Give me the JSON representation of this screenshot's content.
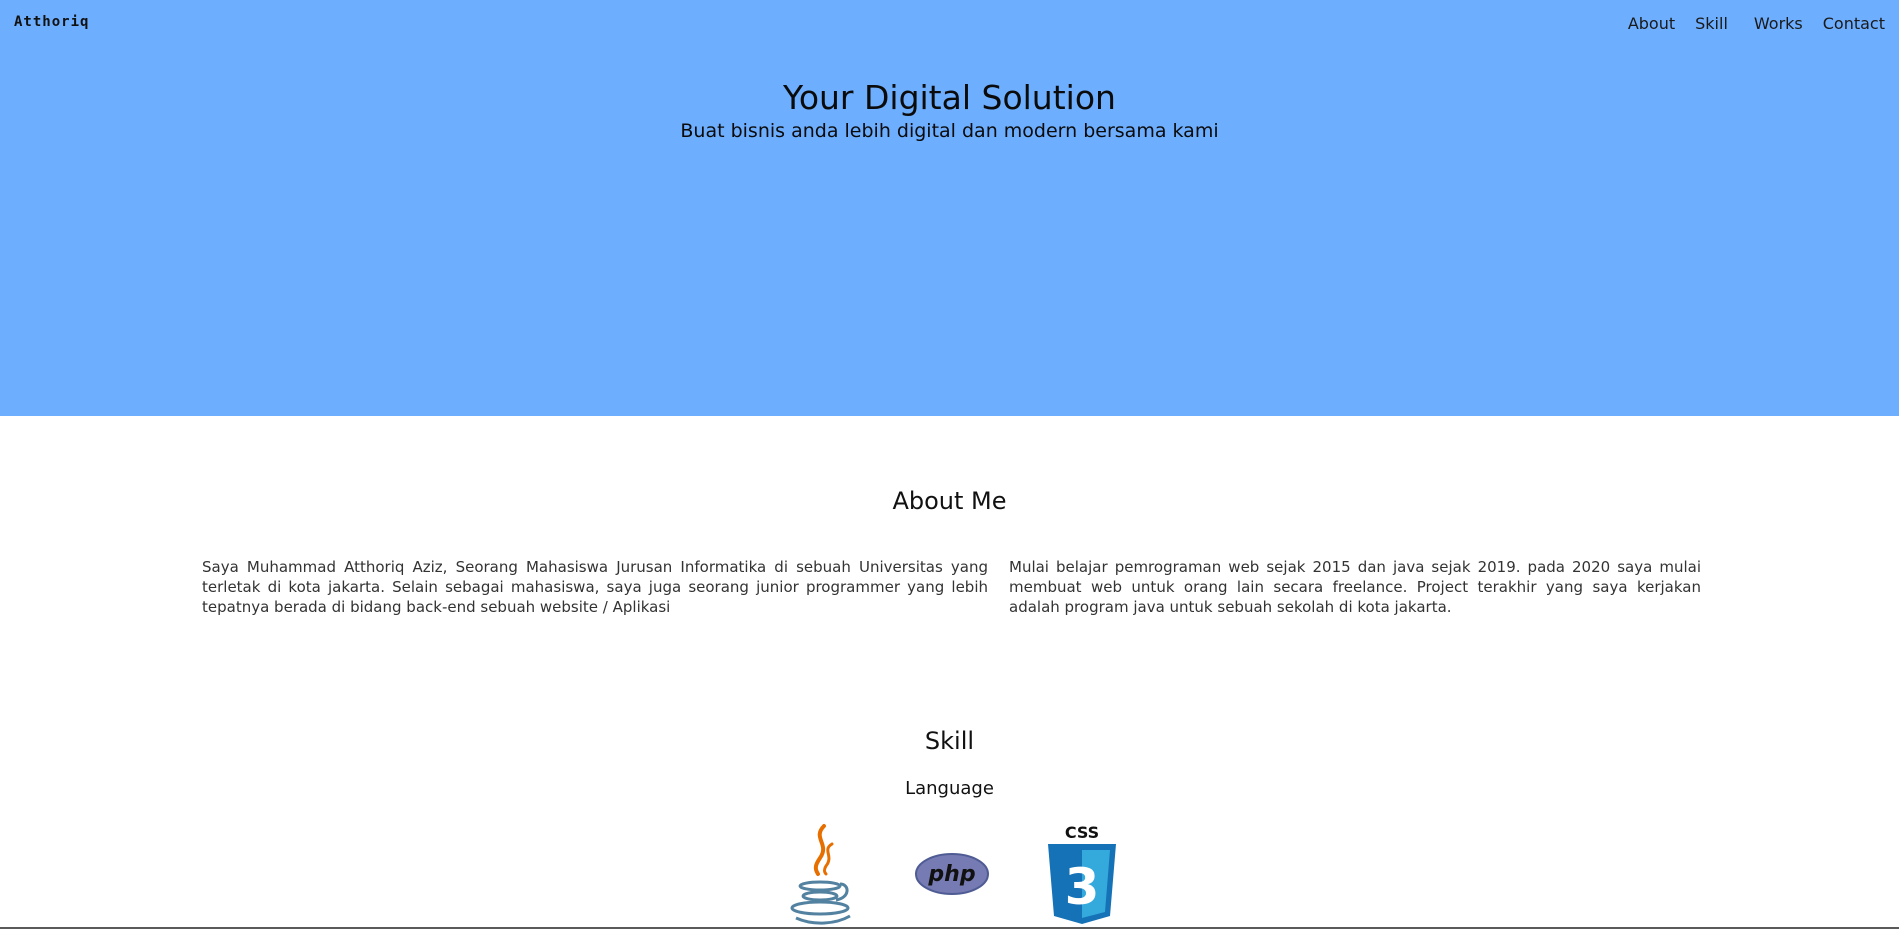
{
  "header": {
    "brand": "Atthoriq",
    "nav": [
      "About",
      "Skill",
      "Works",
      "Contact"
    ]
  },
  "hero": {
    "title": "Your Digital Solution",
    "subtitle": "Buat bisnis anda lebih digital dan modern bersama kami",
    "bg_color": "#6daeff"
  },
  "about": {
    "title": "About Me",
    "left_text": "Saya Muhammad Atthoriq Aziz, Seorang Mahasiswa Jurusan Informatika di sebuah Universitas yang terletak di kota jakarta. Selain sebagai mahasiswa, saya juga seorang junior programmer yang lebih tepatnya berada di bidang back-end sebuah website / Aplikasi",
    "right_text": "Mulai belajar pemrograman web sejak 2015 dan java sejak 2019. pada 2020 saya mulai membuat web untuk orang lain secara freelance. Project terakhir yang saya kerjakan adalah program java untuk sebuah sekolah di kota jakarta."
  },
  "skill": {
    "title": "Skill",
    "subtitle": "Language",
    "logos": [
      {
        "name": "java-icon"
      },
      {
        "name": "php-icon",
        "text": "php"
      },
      {
        "name": "css3-icon",
        "text": "CSS",
        "number": "3"
      }
    ]
  }
}
